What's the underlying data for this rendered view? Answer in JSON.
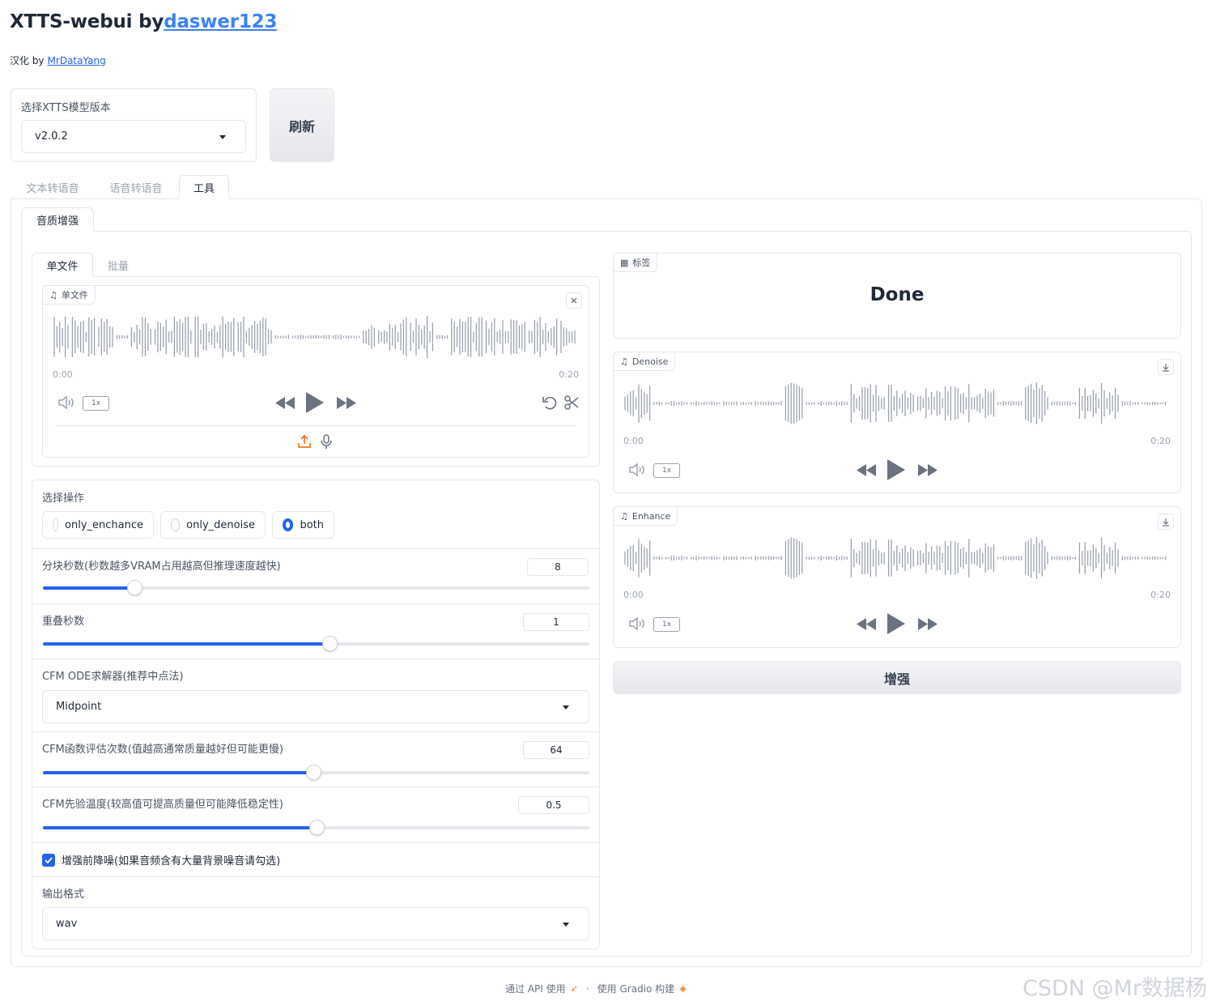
{
  "header": {
    "title_prefix": "XTTS-webui by",
    "title_link": "daswer123",
    "subtitle_prefix": "汉化 by",
    "subtitle_link": "MrDataYang"
  },
  "model": {
    "label": "选择XTTS模型版本",
    "value": "v2.0.2",
    "refresh_label": "刷新"
  },
  "main_tabs": [
    "文本转语音",
    "语音转语音",
    "工具"
  ],
  "sub_tab": "音质增强",
  "file_tabs": [
    "单文件",
    "批量"
  ],
  "input_audio": {
    "label": "单文件",
    "time_start": "0:00",
    "time_end": "0:20",
    "rate": "1x"
  },
  "operation": {
    "label": "选择操作",
    "options": [
      "only_enchance",
      "only_denoise",
      "both"
    ],
    "selected": "both"
  },
  "chunk": {
    "label": "分块秒数(秒数越多VRAM占用越高但推理速度越快)",
    "value": "8",
    "fraction": 0.168
  },
  "overlap": {
    "label": "重叠秒数",
    "value": "1",
    "fraction": 0.525
  },
  "solver": {
    "label": "CFM ODE求解器(推荐中点法)",
    "value": "Midpoint"
  },
  "nfe": {
    "label": "CFM函数评估次数(值越高通常质量越好但可能更慢)",
    "value": "64",
    "fraction": 0.495
  },
  "tau": {
    "label": "CFM先验温度(较高值可提高质量但可能降低稳定性)",
    "value": "0.5",
    "fraction": 0.5
  },
  "denoise_check": {
    "label": "增强前降噪(如果音频含有大量背景噪音请勾选)",
    "checked": true
  },
  "output_format": {
    "label": "输出格式",
    "value": "wav"
  },
  "status": {
    "label": "标签",
    "value": "Done"
  },
  "denoise_audio": {
    "label": "Denoise",
    "time_start": "0:00",
    "time_end": "0:20",
    "rate": "1x"
  },
  "enhance_audio": {
    "label": "Enhance",
    "time_start": "0:00",
    "time_end": "0:20",
    "rate": "1x"
  },
  "enhance_button": "增强",
  "footer": {
    "api": "通过 API 使用",
    "dot": "·",
    "built": "使用 Gradio 构建"
  },
  "watermark": "CSDN @Mr数据杨",
  "colors": {
    "accent": "#2563eb",
    "link": "#3b82f6",
    "wave": "#9ca3af",
    "upload": "#f97316"
  }
}
